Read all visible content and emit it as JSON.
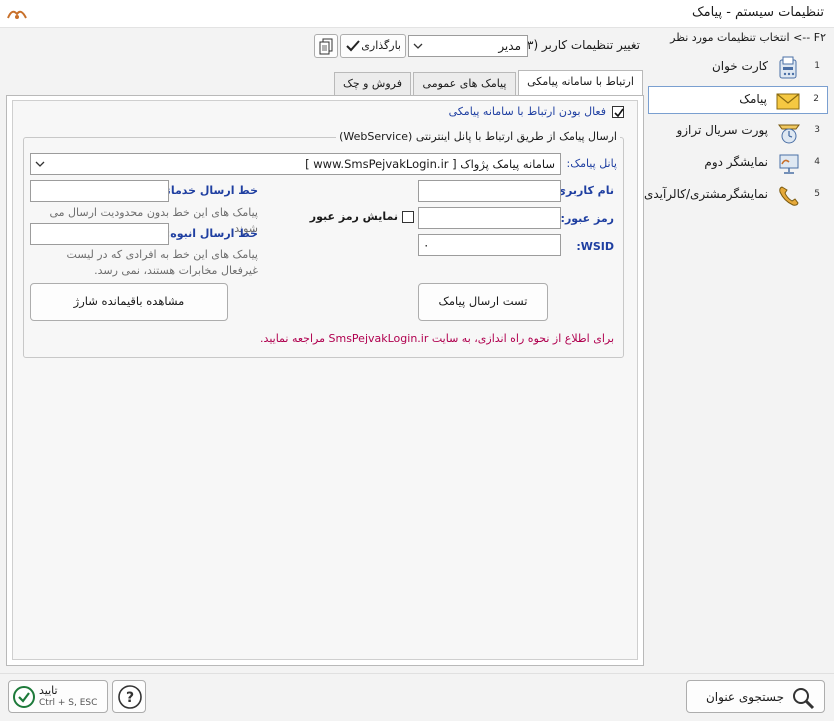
{
  "window": {
    "title": "تنظیمات سیستم - پیامک"
  },
  "sidebar": {
    "header": "F۲ --> انتخاب تنظیمات مورد نظر",
    "items": [
      {
        "num": "1",
        "label": "کارت خوان",
        "icon": "card-reader-icon"
      },
      {
        "num": "2",
        "label": "پیامک",
        "icon": "envelope-icon"
      },
      {
        "num": "3",
        "label": "پورت سریال ترازو",
        "icon": "scale-icon"
      },
      {
        "num": "4",
        "label": "نمایشگر دوم",
        "icon": "monitor-icon"
      },
      {
        "num": "5",
        "label": "نمایشگرمشتری/کالرآیدی",
        "icon": "phone-icon"
      }
    ]
  },
  "toolbar": {
    "user_settings_label": "تغییر تنظیمات کاربر (F۳):",
    "user_select_value": "مدیر",
    "load_button": "بارگذاری"
  },
  "tabs": [
    "ارتباط با سامانه پیامکی",
    "پیامک های عمومی",
    "فروش و چک"
  ],
  "form": {
    "enable_checkbox_label": "فعال بودن ارتباط با سامانه پیامکی",
    "group_title": "ارسال پیامک از طریق ارتباط با پانل اینترنتی (WebService)",
    "panel_label": "پانل پیامک:",
    "panel_value": "سامانه پیامک پژواک [ www.SmsPejvakLogin.ir ]",
    "username_label": "نام کاربری:",
    "password_label": "رمز عبور:",
    "wsid_label": "WSID:",
    "wsid_value": "۰",
    "show_password_label": "نمایش رمز عبور",
    "service_line_label": "خط ارسال خدماتی:",
    "service_line_hint": "پیامک های این خط بدون محدودیت ارسال می شوند.",
    "bulk_line_label": "خط ارسال انبوه:",
    "bulk_line_hint": "پیامک های این خط به افرادی که در لیست غیرفعال مخابرات هستند، نمی رسد.",
    "test_button": "تست ارسال پیامک",
    "balance_button": "مشاهده باقیمانده شارژ",
    "info_text": "برای اطلاع از نحوه راه اندازی، به سایت SmsPejvakLogin.ir مراجعه نمایید."
  },
  "footer": {
    "search_button": "جستجوی عنوان",
    "confirm_label": "تایید",
    "confirm_shortcut": "Ctrl + S, ESC",
    "help_icon": "help-icon"
  },
  "colors": {
    "accent_blue": "#1f3fa1",
    "info_red": "#b0004f",
    "active_border": "#7a9fd0"
  }
}
